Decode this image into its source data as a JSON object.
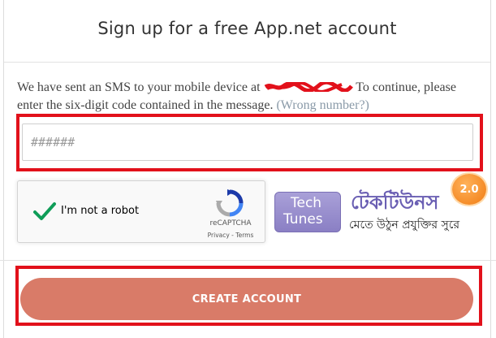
{
  "header": {
    "title": "Sign up for a free App.net account"
  },
  "message": {
    "text_before": "We have sent an SMS to your mobile device at",
    "text_after": " To continue, please enter the six-digit code contained in the message.",
    "wrong_number_link": "(Wrong number?)"
  },
  "code_field": {
    "placeholder": "######",
    "value": ""
  },
  "recaptcha": {
    "label": "I'm not a robot",
    "brand": "reCAPTCHA",
    "links": "Privacy - Terms"
  },
  "watermark": {
    "logo_line1": "Tech",
    "logo_line2": "Tunes",
    "title_bn": "টেকটিউনস",
    "subtitle_bn": "মেতে উঠুন প্রযুক্তির সুরে",
    "badge": "2.0"
  },
  "actions": {
    "create_account_label": "CREATE ACCOUNT"
  },
  "colors": {
    "button": "#d97b68",
    "highlight": "#e2111b",
    "link": "#8a9aa8",
    "check": "#0f9d58",
    "redaction": "#e2111b"
  }
}
